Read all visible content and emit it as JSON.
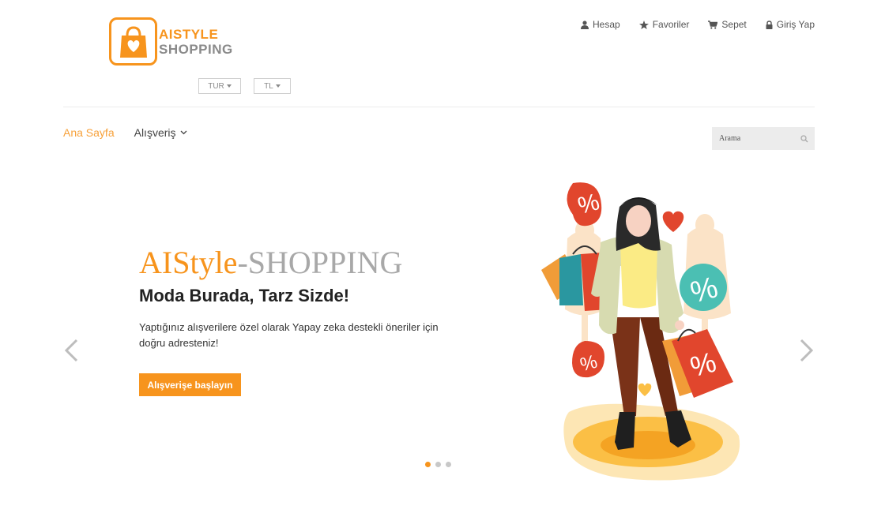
{
  "brand": {
    "line1": "AISTYLE",
    "line2": "SHOPPING"
  },
  "selectors": {
    "language": "TUR",
    "currency": "TL"
  },
  "top_links": [
    {
      "label": "Hesap",
      "icon": "user-icon"
    },
    {
      "label": "Favoriler",
      "icon": "star-icon"
    },
    {
      "label": "Sepet",
      "icon": "cart-icon"
    },
    {
      "label": "Giriş Yap",
      "icon": "lock-icon"
    }
  ],
  "nav": {
    "home": "Ana Sayfa",
    "shopping": "Alışveriş"
  },
  "search": {
    "placeholder": "Arama"
  },
  "hero": {
    "title_part1": "AIStyle",
    "title_part2": "-SHOPPING",
    "subtitle": "Moda Burada, Tarz Sizde!",
    "description": "Yaptığınız alışverilere özel olarak Yapay zeka destekli öneriler için doğru adresteniz!",
    "button": "Alışverişe başlayın"
  },
  "carousel": {
    "slide_count": 3,
    "active_index": 0
  },
  "colors": {
    "accent": "#f7941d",
    "gray_text": "#8a8a8a"
  }
}
